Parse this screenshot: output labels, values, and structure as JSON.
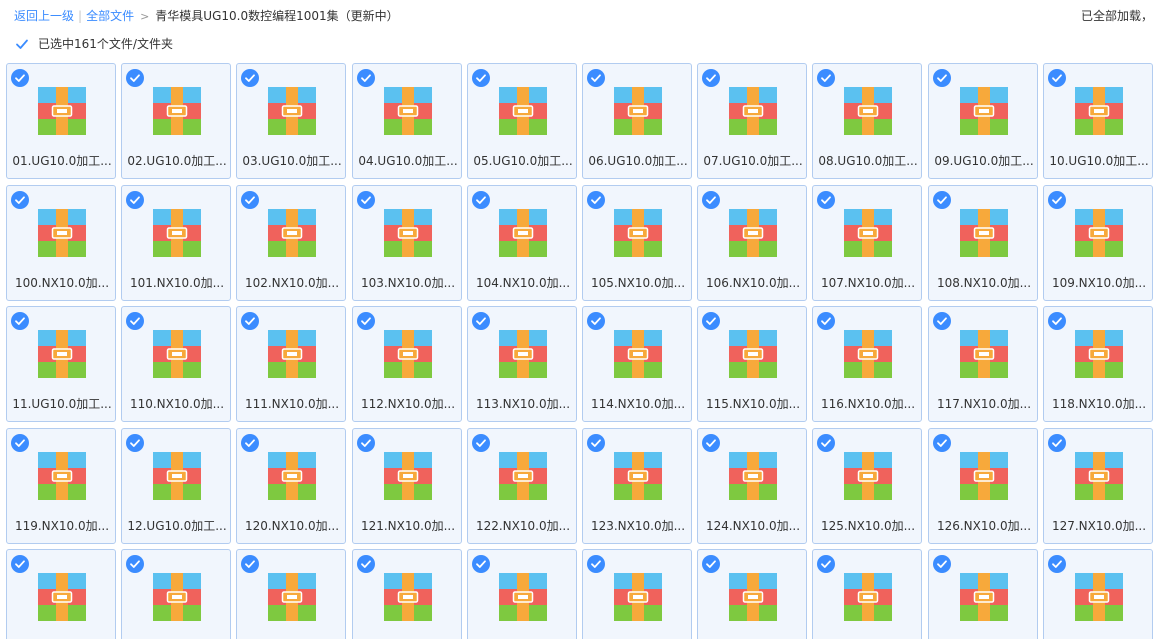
{
  "breadcrumb": {
    "back_label": "返回上一级",
    "all_files_label": "全部文件",
    "separator": "|",
    "arrow": ">",
    "current_folder": "青华模具UG10.0数控编程1001集（更新中）"
  },
  "load_status": "已全部加载，",
  "selection": {
    "label": "已选中161个文件/文件夹",
    "checked": true
  },
  "colors": {
    "accent": "#3b8cff",
    "tile_bg": "#f1f6fd",
    "tile_border": "#b2ccf0",
    "icon_blue": "#5bc1f0",
    "icon_red": "#f0625c",
    "icon_green": "#7ec940",
    "icon_band": "#f7a93b"
  },
  "file_icon": "archive-zip-icon",
  "check_icon": "checkmark-circle-icon",
  "files": [
    {
      "name": "01.UG10.0加工...",
      "selected": true
    },
    {
      "name": "02.UG10.0加工...",
      "selected": true
    },
    {
      "name": "03.UG10.0加工...",
      "selected": true
    },
    {
      "name": "04.UG10.0加工...",
      "selected": true
    },
    {
      "name": "05.UG10.0加工...",
      "selected": true
    },
    {
      "name": "06.UG10.0加工...",
      "selected": true
    },
    {
      "name": "07.UG10.0加工...",
      "selected": true
    },
    {
      "name": "08.UG10.0加工...",
      "selected": true
    },
    {
      "name": "09.UG10.0加工...",
      "selected": true
    },
    {
      "name": "10.UG10.0加工...",
      "selected": true
    },
    {
      "name": "100.NX10.0加...",
      "selected": true
    },
    {
      "name": "101.NX10.0加...",
      "selected": true
    },
    {
      "name": "102.NX10.0加...",
      "selected": true
    },
    {
      "name": "103.NX10.0加...",
      "selected": true
    },
    {
      "name": "104.NX10.0加...",
      "selected": true
    },
    {
      "name": "105.NX10.0加...",
      "selected": true
    },
    {
      "name": "106.NX10.0加...",
      "selected": true
    },
    {
      "name": "107.NX10.0加...",
      "selected": true
    },
    {
      "name": "108.NX10.0加...",
      "selected": true
    },
    {
      "name": "109.NX10.0加...",
      "selected": true
    },
    {
      "name": "11.UG10.0加工...",
      "selected": true
    },
    {
      "name": "110.NX10.0加...",
      "selected": true
    },
    {
      "name": "111.NX10.0加...",
      "selected": true
    },
    {
      "name": "112.NX10.0加...",
      "selected": true
    },
    {
      "name": "113.NX10.0加...",
      "selected": true
    },
    {
      "name": "114.NX10.0加...",
      "selected": true
    },
    {
      "name": "115.NX10.0加...",
      "selected": true
    },
    {
      "name": "116.NX10.0加...",
      "selected": true
    },
    {
      "name": "117.NX10.0加...",
      "selected": true
    },
    {
      "name": "118.NX10.0加...",
      "selected": true
    },
    {
      "name": "119.NX10.0加...",
      "selected": true
    },
    {
      "name": "12.UG10.0加工...",
      "selected": true
    },
    {
      "name": "120.NX10.0加...",
      "selected": true
    },
    {
      "name": "121.NX10.0加...",
      "selected": true
    },
    {
      "name": "122.NX10.0加...",
      "selected": true
    },
    {
      "name": "123.NX10.0加...",
      "selected": true
    },
    {
      "name": "124.NX10.0加...",
      "selected": true
    },
    {
      "name": "125.NX10.0加...",
      "selected": true
    },
    {
      "name": "126.NX10.0加...",
      "selected": true
    },
    {
      "name": "127.NX10.0加...",
      "selected": true
    },
    {
      "name": "",
      "selected": true
    },
    {
      "name": "",
      "selected": true
    },
    {
      "name": "",
      "selected": true
    },
    {
      "name": "",
      "selected": true
    },
    {
      "name": "",
      "selected": true
    },
    {
      "name": "",
      "selected": true
    },
    {
      "name": "",
      "selected": true
    },
    {
      "name": "",
      "selected": true
    },
    {
      "name": "",
      "selected": true
    },
    {
      "name": "",
      "selected": true
    }
  ]
}
